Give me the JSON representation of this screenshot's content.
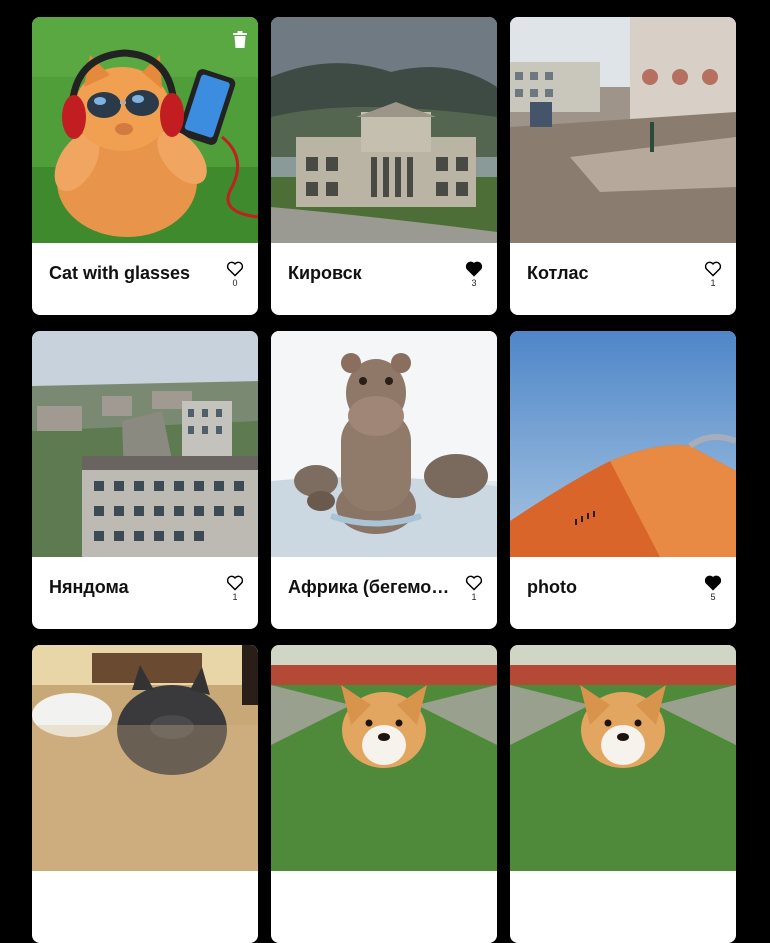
{
  "cards": [
    {
      "title": "Cat with glasses",
      "likes": "0",
      "liked": false,
      "photo": "cat-with-headphones-photo",
      "deletable": true
    },
    {
      "title": "Кировск",
      "likes": "3",
      "liked": true,
      "photo": "kirovsk-building-photo"
    },
    {
      "title": "Котлас",
      "likes": "1",
      "liked": false,
      "photo": "kotlas-street-photo"
    },
    {
      "title": "Няндома",
      "likes": "1",
      "liked": false,
      "photo": "nyandoma-town-photo"
    },
    {
      "title": "Африка (бегемо…",
      "likes": "1",
      "liked": false,
      "photo": "hippos-in-water-photo"
    },
    {
      "title": "photo",
      "likes": "5",
      "liked": true,
      "photo": "desert-dune-photo"
    },
    {
      "title": "",
      "likes": "",
      "photo": "kitten-photo"
    },
    {
      "title": "",
      "likes": "",
      "photo": "corgi-photo"
    },
    {
      "title": "",
      "likes": "",
      "photo": "corgi-photo"
    }
  ],
  "icons": {
    "delete": "trash-icon",
    "like": "heart-icon"
  }
}
